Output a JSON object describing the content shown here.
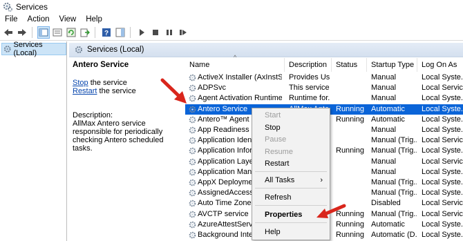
{
  "window": {
    "title": "Services"
  },
  "menu": [
    "File",
    "Action",
    "View",
    "Help"
  ],
  "toolbar": {
    "icons": [
      "back-arrow-icon",
      "forward-arrow-icon",
      "show-console-tree-icon",
      "properties-icon",
      "refresh-icon",
      "export-list-icon",
      "help-icon",
      "action-pane-icon",
      "start-service-icon",
      "stop-service-icon",
      "pause-service-icon",
      "resume-service-icon"
    ]
  },
  "tree": {
    "selected": "Services (Local)"
  },
  "pane": {
    "header": "Services (Local)"
  },
  "detail": {
    "service_name": "Antero Service",
    "stop_link": "Stop",
    "stop_suffix": " the service",
    "restart_link": "Restart",
    "restart_suffix": " the service",
    "description_label": "Description:",
    "description": "AllMax Antero service responsible for periodically checking Antero scheduled tasks."
  },
  "columns": [
    "Name",
    "Description",
    "Status",
    "Startup Type",
    "Log On As"
  ],
  "rows": [
    {
      "name": "ActiveX Installer (AxInstSV)",
      "description": "Provides Us...",
      "status": "",
      "startup": "Manual",
      "logon": "Local Syste..."
    },
    {
      "name": "ADPSvc",
      "description": "This service ...",
      "status": "",
      "startup": "Manual",
      "logon": "Local Service"
    },
    {
      "name": "Agent Activation Runtime_...",
      "description": "Runtime for...",
      "status": "",
      "startup": "Manual",
      "logon": "Local Syste..."
    },
    {
      "name": "Antero Service",
      "description": "AllMax Ante...",
      "status": "Running",
      "startup": "Automatic",
      "logon": "Local Syste..."
    },
    {
      "name": "Antero™ Agent",
      "description": "",
      "status": "Running",
      "startup": "Automatic",
      "logon": "Local Syste..."
    },
    {
      "name": "App Readiness",
      "description": "",
      "status": "",
      "startup": "Manual",
      "logon": "Local Syste..."
    },
    {
      "name": "Application Identity",
      "description": "",
      "status": "",
      "startup": "Manual (Trig...",
      "logon": "Local Service"
    },
    {
      "name": "Application Information",
      "description": "",
      "status": "Running",
      "startup": "Manual (Trig...",
      "logon": "Local Syste..."
    },
    {
      "name": "Application Layer",
      "description": "",
      "status": "",
      "startup": "Manual",
      "logon": "Local Service"
    },
    {
      "name": "Application Management",
      "description": "",
      "status": "",
      "startup": "Manual",
      "logon": "Local Syste..."
    },
    {
      "name": "AppX Deployment",
      "description": "",
      "status": "",
      "startup": "Manual (Trig...",
      "logon": "Local Syste..."
    },
    {
      "name": "AssignedAccess",
      "description": "",
      "status": "",
      "startup": "Manual (Trig...",
      "logon": "Local Syste..."
    },
    {
      "name": "Auto Time Zone",
      "description": "",
      "status": "",
      "startup": "Disabled",
      "logon": "Local Service"
    },
    {
      "name": "AVCTP service",
      "description": "",
      "status": "Running",
      "startup": "Manual (Trig...",
      "logon": "Local Service"
    },
    {
      "name": "AzureAttestService",
      "description": "",
      "status": "Running",
      "startup": "Automatic",
      "logon": "Local Syste..."
    },
    {
      "name": "Background Intelligent",
      "description": "",
      "status": "Running",
      "startup": "Automatic (D...",
      "logon": "Local Syste..."
    }
  ],
  "selected_row": 3,
  "context_menu": {
    "start": "Start",
    "stop": "Stop",
    "pause": "Pause",
    "resume": "Resume",
    "restart": "Restart",
    "all_tasks": "All Tasks",
    "refresh": "Refresh",
    "properties": "Properties",
    "help": "Help"
  },
  "colors": {
    "selection": "#0a64d8",
    "annotation_arrow": "#d9261c",
    "link": "#0645ad"
  }
}
